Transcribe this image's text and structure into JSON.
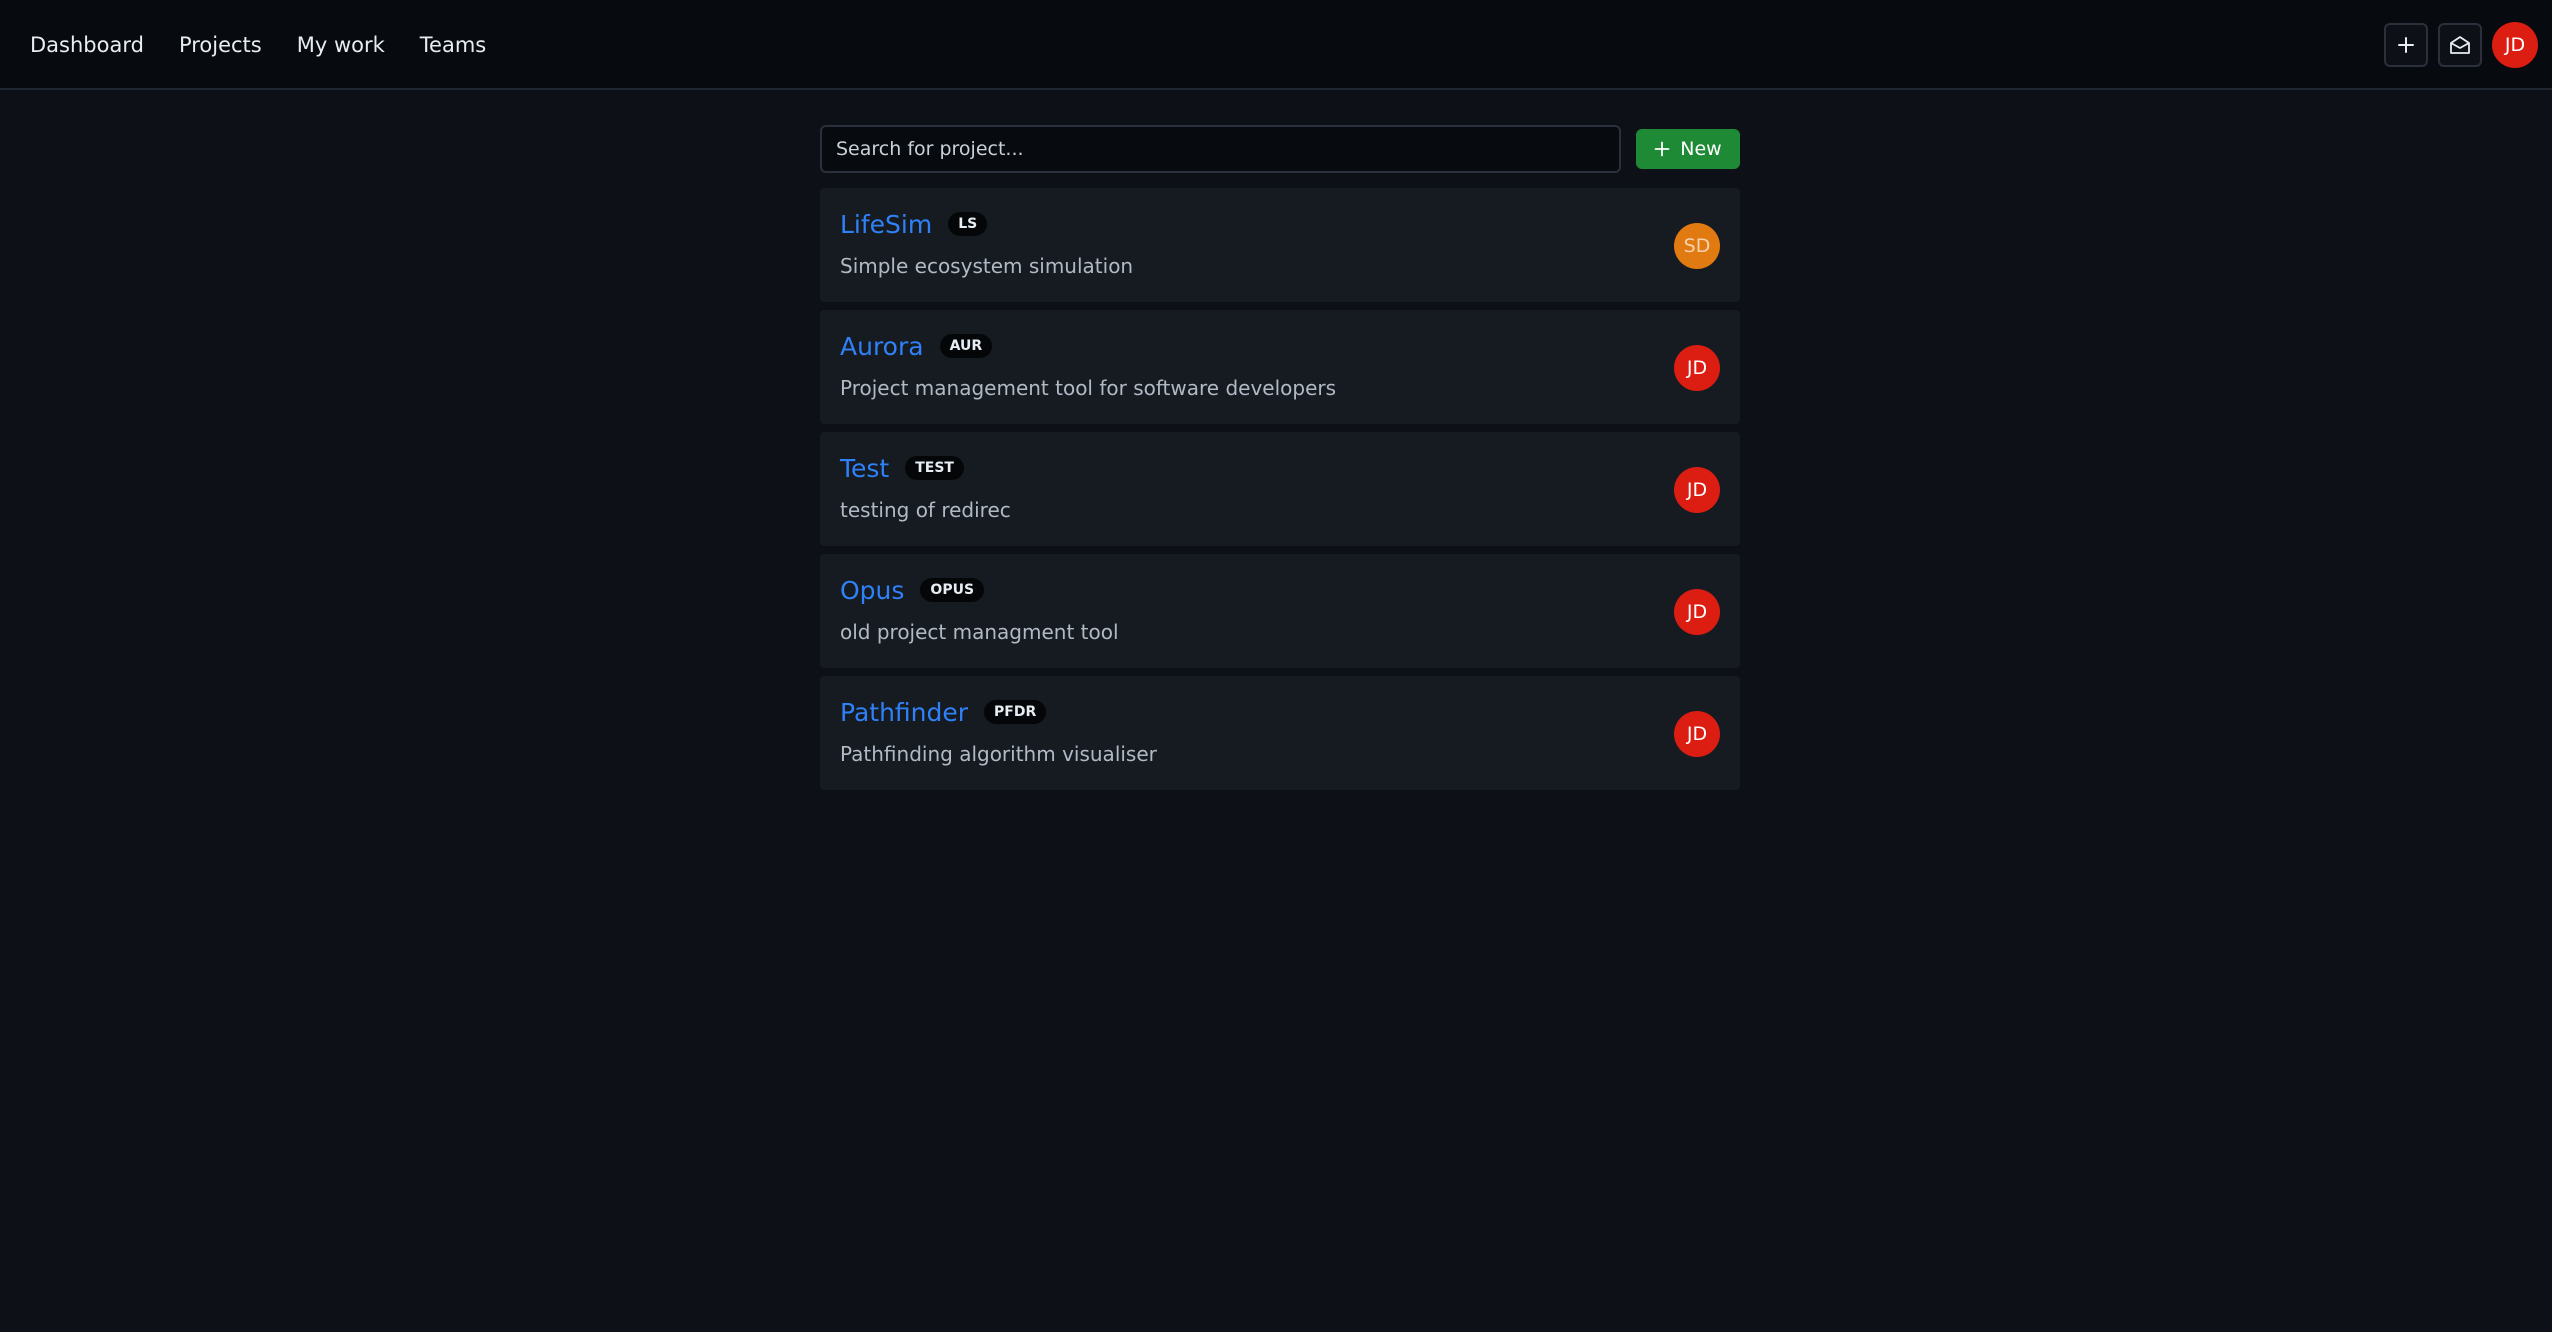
{
  "nav": {
    "items": [
      {
        "label": "Dashboard"
      },
      {
        "label": "Projects"
      },
      {
        "label": "My work"
      },
      {
        "label": "Teams"
      }
    ]
  },
  "header": {
    "actions": {
      "add_icon": "plus-icon",
      "inbox_icon": "mail-open-icon"
    },
    "user": {
      "initials": "JD",
      "color": "#dc1d12"
    }
  },
  "search": {
    "placeholder": "Search for project...",
    "value": ""
  },
  "new_button": {
    "label": "New",
    "icon": "plus-icon",
    "color": "#1e8a35"
  },
  "projects": [
    {
      "name": "LifeSim",
      "key": "LS",
      "description": "Simple ecosystem simulation",
      "owner_initials": "SD",
      "owner_color": "#e27a12",
      "owner_text_color": "#f6d2ae"
    },
    {
      "name": "Aurora",
      "key": "AUR",
      "description": "Project management tool for software developers",
      "owner_initials": "JD",
      "owner_color": "#dc1d12",
      "owner_text_color": "#ffffff"
    },
    {
      "name": "Test",
      "key": "TEST",
      "description": "testing of redirec",
      "owner_initials": "JD",
      "owner_color": "#dc1d12",
      "owner_text_color": "#ffffff"
    },
    {
      "name": "Opus",
      "key": "OPUS",
      "description": "old project managment tool",
      "owner_initials": "JD",
      "owner_color": "#dc1d12",
      "owner_text_color": "#ffffff"
    },
    {
      "name": "Pathfinder",
      "key": "PFDR",
      "description": "Pathfinding algorithm visualiser",
      "owner_initials": "JD",
      "owner_color": "#dc1d12",
      "owner_text_color": "#ffffff"
    }
  ],
  "colors": {
    "page_background": "#0d1117",
    "topbar_background": "#070a0f",
    "card_background": "#161b22",
    "link": "#2f81f7"
  }
}
